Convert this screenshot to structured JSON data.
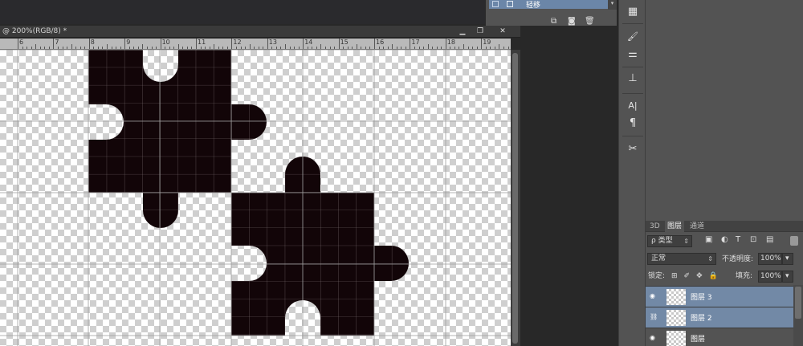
{
  "history": {
    "item_label": "轻移",
    "scroll_arrow": "▾",
    "icons": [
      "new-snapshot-icon",
      "camera-icon",
      "trash-icon"
    ]
  },
  "document": {
    "tab_title": "@ 200%(RGB/8) *",
    "minimize": "▁",
    "restore": "❐",
    "close": "✕"
  },
  "ruler": {
    "numbers": [
      "6",
      "7",
      "8",
      "9",
      "10",
      "11",
      "12",
      "13",
      "14",
      "15",
      "16",
      "17",
      "18",
      "19"
    ]
  },
  "tools": [
    {
      "name": "grid-icon",
      "glyph": "▦"
    },
    {
      "name": "brush-settings-icon",
      "glyph": "🖌"
    },
    {
      "name": "adjustments-icon",
      "glyph": "⚌"
    },
    {
      "name": "stamp-icon",
      "glyph": "⊥"
    },
    {
      "name": "character-icon",
      "glyph": "A|"
    },
    {
      "name": "paragraph-icon",
      "glyph": "¶"
    },
    {
      "name": "tool-presets-icon",
      "glyph": "✂"
    }
  ],
  "layers_panel": {
    "tabs": [
      "3D",
      "图层",
      "通道"
    ],
    "active_tab": "图层",
    "filter_kind": "ρ 类型",
    "blend_mode": "正常",
    "opacity_label": "不透明度:",
    "opacity_value": "100%",
    "lock_label": "锁定:",
    "fill_label": "填充:",
    "fill_value": "100%",
    "layers": [
      {
        "name": "图层 3",
        "selected": true
      },
      {
        "name": "图层 2",
        "selected": true
      },
      {
        "name": "图层",
        "selected": false
      }
    ]
  },
  "colors": {
    "puzzle_fill": "#120508",
    "selection_blue": "#7289a6",
    "panel_bg": "#535353"
  }
}
